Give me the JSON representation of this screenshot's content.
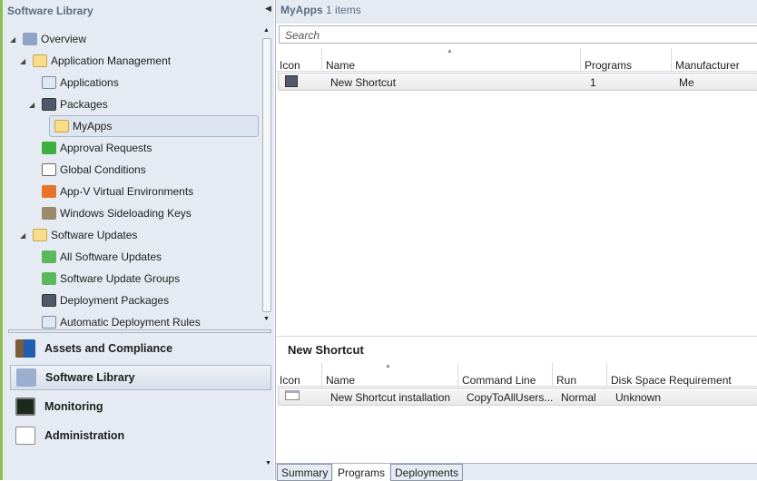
{
  "sidebar": {
    "title": "Software Library",
    "tree": [
      {
        "label": "Overview",
        "icon": "overview-icon"
      },
      {
        "label": "Application Management",
        "icon": "folder-icon"
      },
      {
        "label": "Applications",
        "icon": "applications-icon"
      },
      {
        "label": "Packages",
        "icon": "packages-icon"
      },
      {
        "label": "MyApps",
        "icon": "folder-icon"
      },
      {
        "label": "Approval Requests",
        "icon": "approval-icon"
      },
      {
        "label": "Global Conditions",
        "icon": "conditions-icon"
      },
      {
        "label": "App-V Virtual Environments",
        "icon": "appv-icon"
      },
      {
        "label": "Windows Sideloading Keys",
        "icon": "key-icon"
      },
      {
        "label": "Software Updates",
        "icon": "folder-icon"
      },
      {
        "label": "All Software Updates",
        "icon": "updates-icon"
      },
      {
        "label": "Software Update Groups",
        "icon": "update-groups-icon"
      },
      {
        "label": "Deployment Packages",
        "icon": "packages-icon"
      },
      {
        "label": "Automatic Deployment Rules",
        "icon": "rules-icon"
      }
    ],
    "workspaces": [
      "Assets and Compliance",
      "Software Library",
      "Monitoring",
      "Administration"
    ]
  },
  "main": {
    "title": "MyApps",
    "count": "1 items",
    "search_placeholder": "Search",
    "columns": [
      "Icon",
      "Name",
      "Programs",
      "Manufacturer"
    ],
    "rows": [
      {
        "name": "New Shortcut",
        "programs": "1",
        "manufacturer": "Me"
      }
    ]
  },
  "details": {
    "title": "New Shortcut",
    "columns": [
      "Icon",
      "Name",
      "Command Line",
      "Run",
      "Disk Space Requirement"
    ],
    "rows": [
      {
        "name": "New Shortcut installation",
        "command": "CopyToAllUsers...",
        "run": "Normal",
        "disk": "Unknown"
      }
    ],
    "tabs": [
      "Summary",
      "Programs",
      "Deployments"
    ]
  }
}
